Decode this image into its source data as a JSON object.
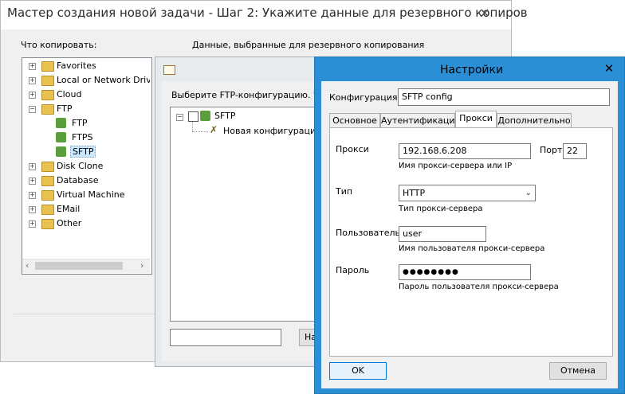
{
  "wizard": {
    "title": "Мастер создания новой задачи - Шаг 2: Укажите данные для резервного копиров",
    "what_label": "Что копировать:",
    "data_label": "Данные, выбранные для резервного копирования",
    "tree": [
      {
        "label": "Favorites"
      },
      {
        "label": "Local or Network Drive"
      },
      {
        "label": "Cloud"
      },
      {
        "label": "FTP",
        "children": [
          "FTP",
          "FTPS",
          "SFTP"
        ]
      },
      {
        "label": "Disk Clone"
      },
      {
        "label": "Database"
      },
      {
        "label": "Virtual Machine"
      },
      {
        "label": "EMail"
      },
      {
        "label": "Other"
      }
    ],
    "truncated_d": "Д",
    "truncated_u": "у"
  },
  "ftp_dialog": {
    "prompt": "Выберите FTP-конфигурацию. Чтоб",
    "root": "SFTP",
    "child": "Новая конфигурация",
    "button_partial": "На"
  },
  "settings": {
    "title": "Настройки",
    "config_label": "Конфигурация",
    "config_value": "SFTP config",
    "tabs": [
      "Основное",
      "Аутентификация",
      "Прокси",
      "Дополнительно"
    ],
    "active_tab": "Прокси",
    "proxy": {
      "label": "Прокси",
      "value": "192.168.6.208",
      "hint": "Имя прокси-сервера или IP",
      "port_label": "Порт",
      "port_value": "22"
    },
    "type": {
      "label": "Тип",
      "value": "HTTP",
      "hint": "Тип прокси-сервера"
    },
    "user": {
      "label": "Пользователь",
      "value": "user",
      "hint": "Имя пользователя прокси-сервера"
    },
    "password": {
      "label": "Пароль",
      "value": "●●●●●●●●",
      "hint": "Пароль пользователя прокси-сервера"
    },
    "ok": "OK",
    "cancel": "Отмена"
  },
  "colors": {
    "accent_frame": "#2b8fd6",
    "inactive_frame": "#e8ebee",
    "ok_button": "#e5f1fb"
  }
}
